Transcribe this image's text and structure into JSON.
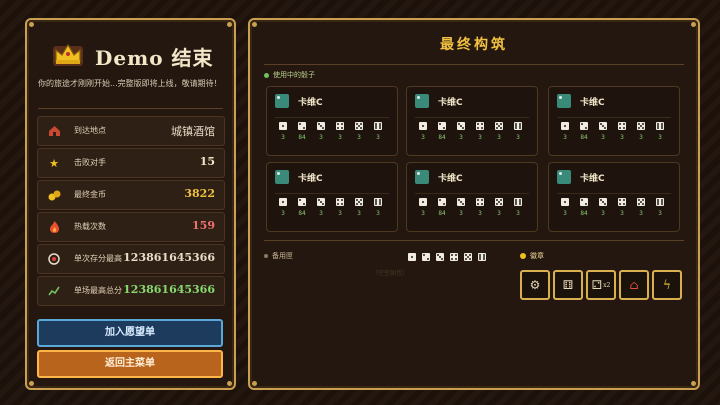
{
  "left": {
    "title": "Demo 结束",
    "intro": "你的旅途才刚刚开始...完整版即将上线，敬请期待！",
    "stats": [
      {
        "label": "到达地点",
        "value": "城镇酒馆",
        "icon": "tavern-icon",
        "color": "#e8dcc8"
      },
      {
        "label": "击败对手",
        "value": "15",
        "icon": "star-icon",
        "color": "#f0e4c8"
      },
      {
        "label": "最终金币",
        "value": "3822",
        "icon": "coins-icon",
        "color": "#f0c040"
      },
      {
        "label": "热载次数",
        "value": "159",
        "icon": "flame-icon",
        "color": "#f07070"
      },
      {
        "label": "单次存分最高",
        "value": "123861645366",
        "icon": "target-icon",
        "color": "#e8dcc8"
      },
      {
        "label": "单场最高总分",
        "value": "123861645366",
        "icon": "chart-icon",
        "color": "#88d870"
      }
    ],
    "wishlist_button": "加入愿望单",
    "menu_button": "返回主菜单"
  },
  "right": {
    "title": "最终构筑",
    "in_use_label": "使用中的骰子",
    "cards": [
      {
        "name": "卡维C",
        "values": [
          "3",
          "84",
          "3",
          "3",
          "3",
          "3"
        ]
      },
      {
        "name": "卡维C",
        "values": [
          "3",
          "84",
          "3",
          "3",
          "3",
          "3"
        ]
      },
      {
        "name": "卡维C",
        "values": [
          "3",
          "84",
          "3",
          "3",
          "3",
          "3"
        ]
      },
      {
        "name": "卡维C",
        "values": [
          "3",
          "84",
          "3",
          "3",
          "3",
          "3"
        ]
      },
      {
        "name": "卡维C",
        "values": [
          "3",
          "84",
          "3",
          "3",
          "3",
          "3"
        ]
      },
      {
        "name": "卡维C",
        "values": [
          "3",
          "84",
          "3",
          "3",
          "3",
          "3"
        ]
      }
    ],
    "bench_label": "备用匣",
    "empty_label": "（空空如也）",
    "badge_label": "徽章",
    "relics": [
      "gear-icon",
      "dice-icon",
      "dice-x2-icon",
      "house-up-icon",
      "lightning-icon"
    ],
    "relic_glyphs": [
      "⚙",
      "⚅",
      "⚁",
      "⌂",
      "ϟ"
    ],
    "x2_label": "x2"
  }
}
